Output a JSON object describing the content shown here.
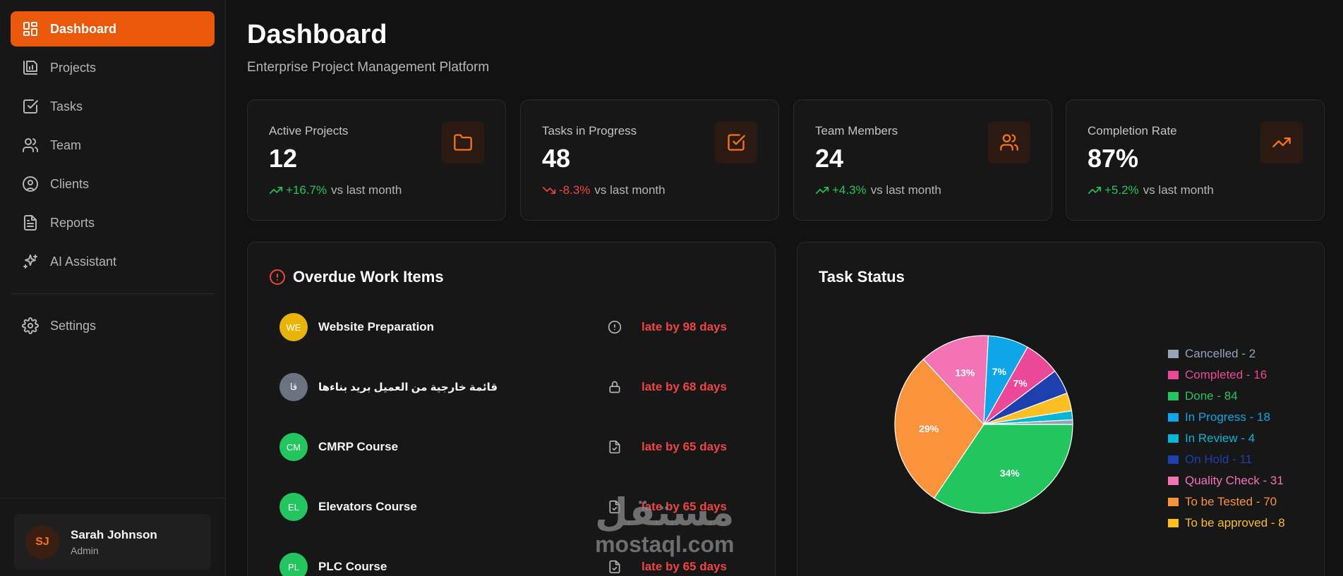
{
  "sidebar": {
    "items": [
      {
        "label": "Dashboard",
        "icon": "dashboard-icon",
        "active": true
      },
      {
        "label": "Projects",
        "icon": "projects-icon"
      },
      {
        "label": "Tasks",
        "icon": "tasks-icon"
      },
      {
        "label": "Team",
        "icon": "team-icon"
      },
      {
        "label": "Clients",
        "icon": "clients-icon"
      },
      {
        "label": "Reports",
        "icon": "reports-icon"
      },
      {
        "label": "AI Assistant",
        "icon": "sparkles-icon"
      }
    ],
    "settings": {
      "label": "Settings",
      "icon": "gear-icon"
    },
    "user": {
      "initials": "SJ",
      "name": "Sarah Johnson",
      "role": "Admin"
    }
  },
  "header": {
    "title": "Dashboard",
    "subtitle": "Enterprise Project Management Platform"
  },
  "stats": [
    {
      "label": "Active Projects",
      "value": "12",
      "delta": "+16.7%",
      "trend": "up",
      "suffix": "vs last month",
      "icon": "folder-icon"
    },
    {
      "label": "Tasks in Progress",
      "value": "48",
      "delta": "-8.3%",
      "trend": "down",
      "suffix": "vs last month",
      "icon": "checkbox-icon"
    },
    {
      "label": "Team Members",
      "value": "24",
      "delta": "+4.3%",
      "trend": "up",
      "suffix": "vs last month",
      "icon": "users-icon"
    },
    {
      "label": "Completion Rate",
      "value": "87%",
      "delta": "+5.2%",
      "trend": "up",
      "suffix": "vs last month",
      "icon": "trending-up-icon"
    }
  ],
  "overdue": {
    "title": "Overdue Work Items",
    "items": [
      {
        "initials": "WE",
        "name": "Website Preparation",
        "late": "late by 98 days",
        "color": "#eab308",
        "status_icon": "alert-circle-icon"
      },
      {
        "initials": "قا",
        "name": "قائمة خارجية من العميل بريد بناءها",
        "late": "late by 68 days",
        "color": "#6b7280",
        "status_icon": "lock-icon"
      },
      {
        "initials": "CM",
        "name": "CMRP Course",
        "late": "late by 65 days",
        "color": "#22c55e",
        "status_icon": "file-check-icon"
      },
      {
        "initials": "EL",
        "name": "Elevators Course",
        "late": "late by 65 days",
        "color": "#22c55e",
        "status_icon": "file-check-icon"
      },
      {
        "initials": "PL",
        "name": "PLC Course",
        "late": "late by 65 days",
        "color": "#22c55e",
        "status_icon": "file-check-icon"
      }
    ]
  },
  "task_status": {
    "title": "Task Status"
  },
  "chart_data": {
    "type": "pie",
    "categories": [
      "Cancelled",
      "Completed",
      "Done",
      "In Progress",
      "In Review",
      "On Hold",
      "Quality Check",
      "To be Tested",
      "To be approved"
    ],
    "values": [
      2,
      16,
      84,
      18,
      4,
      11,
      31,
      70,
      8
    ],
    "legend": [
      "Cancelled - 2",
      "Completed - 16",
      "Done - 84",
      "In Progress - 18",
      "In Review - 4",
      "On Hold - 11",
      "Quality Check - 31",
      "To be Tested - 70",
      "To be approved - 8"
    ],
    "colors": [
      "#94a3b8",
      "#ec4899",
      "#22c55e",
      "#0ea5e9",
      "#06b6d4",
      "#1e40af",
      "#f472b6",
      "#fb923c",
      "#fbbf24"
    ],
    "slice_labels": [
      "34%",
      "29%",
      "13%",
      "7%",
      "7%"
    ],
    "legend_position": "right"
  },
  "watermark": {
    "arabic": "مستقل",
    "latin": "mostaql.com"
  }
}
